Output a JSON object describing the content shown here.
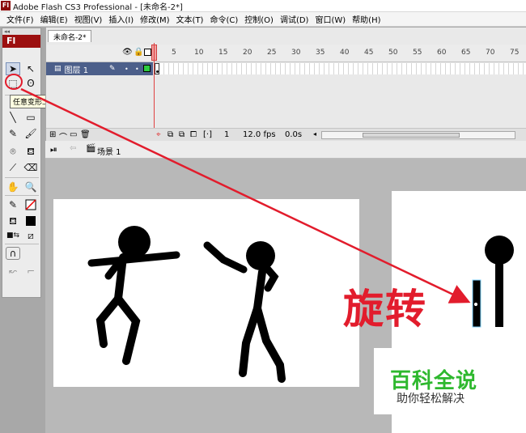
{
  "window": {
    "logo": "Fl",
    "title": "Adobe Flash CS3 Professional - [未命名-2*]"
  },
  "menu": [
    "文件(F)",
    "编辑(E)",
    "视图(V)",
    "插入(I)",
    "修改(M)",
    "文本(T)",
    "命令(C)",
    "控制(O)",
    "调试(D)",
    "窗口(W)",
    "帮助(H)"
  ],
  "toolbox": {
    "header": "Fl",
    "tooltip": "任意变形工具 (Q,F)"
  },
  "timeline": {
    "document_tab": "未命名-2*",
    "ruler": [
      "5",
      "10",
      "15",
      "20",
      "25",
      "30",
      "35",
      "40",
      "45",
      "50",
      "55",
      "60",
      "65",
      "70",
      "75"
    ],
    "layer_name": "图层 1",
    "current_frame": "1",
    "frame_rate": "12.0 fps",
    "elapsed_time": "0.0s"
  },
  "edit_bar": {
    "scene": "场景 1"
  },
  "stage": {
    "annotation": "旋转"
  },
  "watermark": {
    "title": "百科全说",
    "subtitle": "助你轻松解决"
  },
  "colors": {
    "annotation_red": "#e21c2c",
    "flash_red": "#9c0f0f",
    "layer_selected": "#4c5f8a",
    "watermark_green": "#2eb82e"
  }
}
